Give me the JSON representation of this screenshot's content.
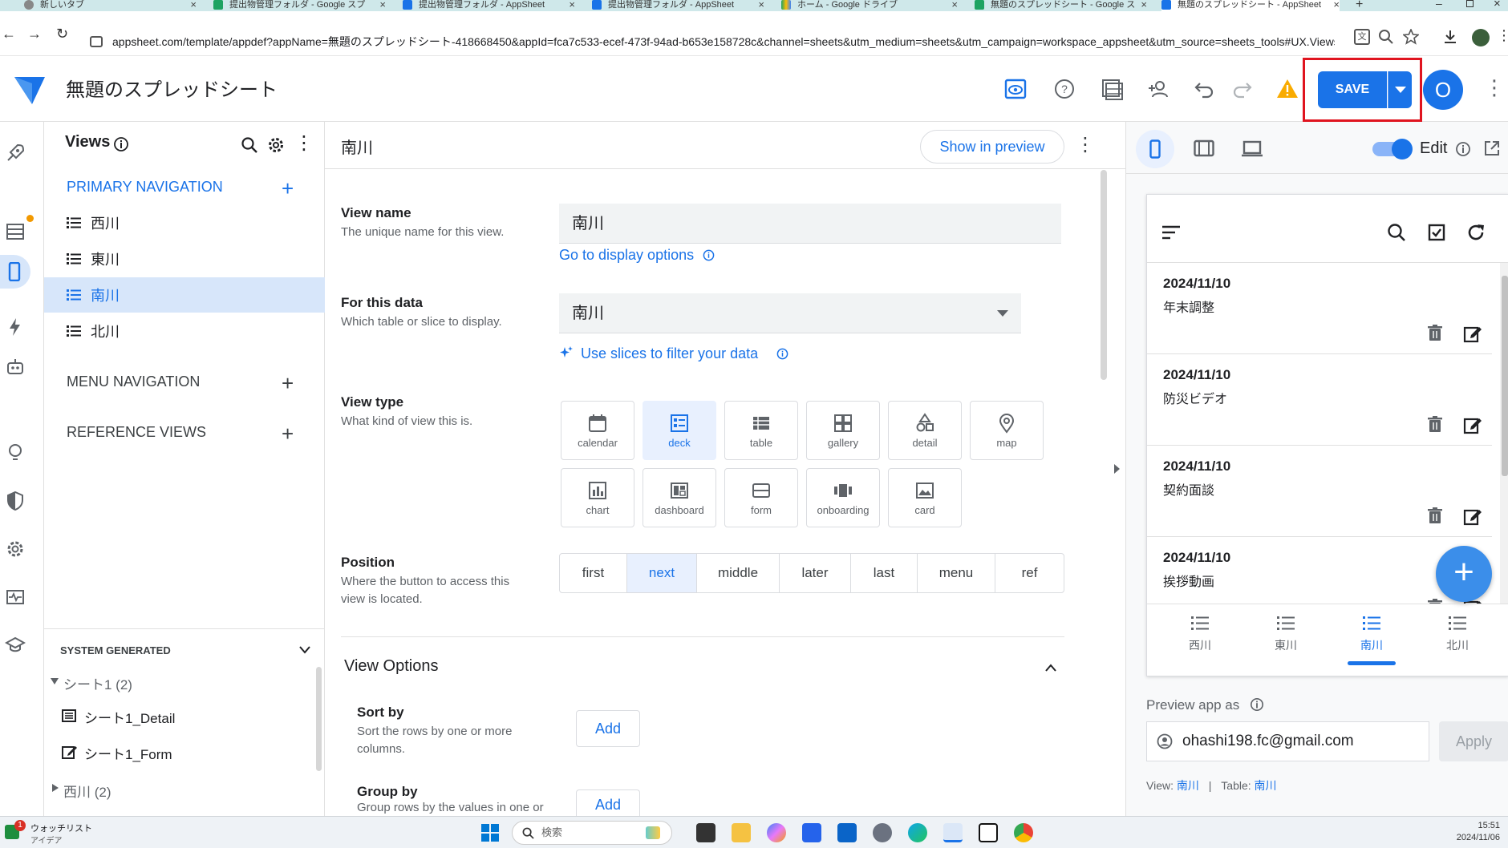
{
  "browser": {
    "tabs": [
      {
        "label": "新しいタブ",
        "icon": "chrome-icon"
      },
      {
        "label": "提出物管理フォルダ - Google スプ",
        "icon": "sheets-icon"
      },
      {
        "label": "提出物管理フォルダ - AppSheet",
        "icon": "appsheet-icon"
      },
      {
        "label": "提出物管理フォルダ - AppSheet",
        "icon": "appsheet-icon"
      },
      {
        "label": "ホーム - Google ドライブ",
        "icon": "drive-icon"
      },
      {
        "label": "無題のスプレッドシート - Google ス",
        "icon": "sheets-icon"
      },
      {
        "label": "無題のスプレッドシート - AppSheet",
        "icon": "appsheet-icon"
      }
    ],
    "url": "appsheet.com/template/appdef?appName=無題のスプレッドシート-418668450&appId=fca7c533-ecef-473f-94ad-b653e158728c&channel=sheets&utm_medium=sheets&utm_campaign=workspace_appsheet&utm_source=sheets_tools#UX.Views.南川"
  },
  "header": {
    "app_title": "無題のスプレッドシート",
    "save_label": "SAVE",
    "avatar_letter": "O",
    "brand_color": "#1a73e8",
    "highlight_color": "#e0141f"
  },
  "left_panel": {
    "title": "Views",
    "primary_nav_label": "PRIMARY NAVIGATION",
    "primary_items": [
      "西川",
      "東川",
      "南川",
      "北川"
    ],
    "selected_item": "南川",
    "menu_nav_label": "MENU NAVIGATION",
    "reference_views_label": "REFERENCE VIEWS",
    "system_generated_label": "SYSTEM GENERATED",
    "system_items": [
      {
        "label": "シート1 (2)",
        "kind": "group"
      },
      {
        "label": "シート1_Detail",
        "kind": "detail"
      },
      {
        "label": "シート1_Form",
        "kind": "form"
      },
      {
        "label": "西川 (2)",
        "kind": "group"
      }
    ]
  },
  "main": {
    "view_title": "南川",
    "show_in_preview": "Show in preview",
    "view_name": {
      "label": "View name",
      "desc": "The unique name for this view.",
      "value": "南川",
      "link": "Go to display options"
    },
    "for_this_data": {
      "label": "For this data",
      "desc": "Which table or slice to display.",
      "value": "南川",
      "link": "Use slices to filter your data"
    },
    "view_type": {
      "label": "View type",
      "desc": "What kind of view this is.",
      "options": [
        "calendar",
        "deck",
        "table",
        "gallery",
        "detail",
        "map",
        "chart",
        "dashboard",
        "form",
        "onboarding",
        "card"
      ],
      "selected": "deck"
    },
    "position": {
      "label": "Position",
      "desc": "Where the button to access this view is located.",
      "options": [
        "first",
        "next",
        "middle",
        "later",
        "last",
        "menu",
        "ref"
      ],
      "selected": "next"
    },
    "view_options": {
      "title": "View Options",
      "sort_by": {
        "label": "Sort by",
        "desc": "Sort the rows by one or more columns.",
        "button": "Add"
      },
      "group_by": {
        "label": "Group by",
        "desc": "Group rows by the values in one or",
        "button": "Add"
      }
    }
  },
  "preview": {
    "edit_label": "Edit",
    "cards": [
      {
        "date": "2024/11/10",
        "title": "年末調整"
      },
      {
        "date": "2024/11/10",
        "title": "防災ビデオ"
      },
      {
        "date": "2024/11/10",
        "title": "契約面談"
      },
      {
        "date": "2024/11/10",
        "title": "挨拶動画"
      }
    ],
    "bottom_tabs": [
      "西川",
      "東川",
      "南川",
      "北川"
    ],
    "selected_tab": "南川",
    "preview_as_label": "Preview app as",
    "email": "ohashi198.fc@gmail.com",
    "apply_label": "Apply",
    "footer": {
      "view_label": "View:",
      "view_value": "南川",
      "sep": "|",
      "table_label": "Table:",
      "table_value": "南川"
    }
  },
  "taskbar": {
    "watchlist_title": "ウォッチリスト",
    "watchlist_sub": "アイデア",
    "badge": "1",
    "search_placeholder": "検索",
    "time": "15:51",
    "date": "2024/11/06"
  }
}
